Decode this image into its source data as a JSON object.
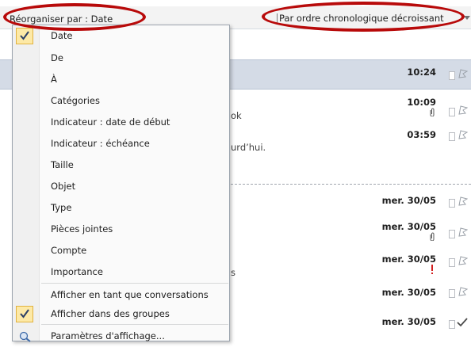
{
  "arrange_bar": {
    "arrange_by": "Réorganiser par : Date",
    "order": "Par ordre chronologique décroissant"
  },
  "menu": {
    "items": [
      {
        "label": "Date",
        "checked": true
      },
      {
        "label": "De",
        "checked": false
      },
      {
        "label": "À",
        "checked": false
      },
      {
        "label": "Catégories",
        "checked": false
      },
      {
        "label": "Indicateur : date de début",
        "checked": false
      },
      {
        "label": "Indicateur : échéance",
        "checked": false
      },
      {
        "label": "Taille",
        "checked": false
      },
      {
        "label": "Objet",
        "checked": false
      },
      {
        "label": "Type",
        "checked": false
      },
      {
        "label": "Pièces jointes",
        "checked": false
      },
      {
        "label": "Compte",
        "checked": false
      },
      {
        "label": "Importance",
        "checked": false
      }
    ],
    "view_options": [
      {
        "label": "Afficher en tant que conversations",
        "checked": false
      },
      {
        "label": "Afficher dans des groupes",
        "checked": true
      }
    ],
    "settings_label": "Paramètres d'affichage..."
  },
  "messages": [
    {
      "time": "10:24",
      "selected": true
    },
    {
      "time": "10:09",
      "snippet": "ok",
      "attachment": true
    },
    {
      "time": "03:59",
      "snippet": "urd’hui."
    },
    {
      "time": "mer. 30/05"
    },
    {
      "time": "mer. 30/05",
      "attachment": true
    },
    {
      "time": "mer. 30/05",
      "snippet": "s",
      "important": true
    },
    {
      "time": "mer. 30/05"
    },
    {
      "time": "mer. 30/05",
      "completed": true
    }
  ],
  "colors": {
    "annotation_ring": "#b80a0a",
    "selected_row": "#d4dbe6",
    "check_highlight": "#fde9a6",
    "importance": "#d21e1e"
  }
}
